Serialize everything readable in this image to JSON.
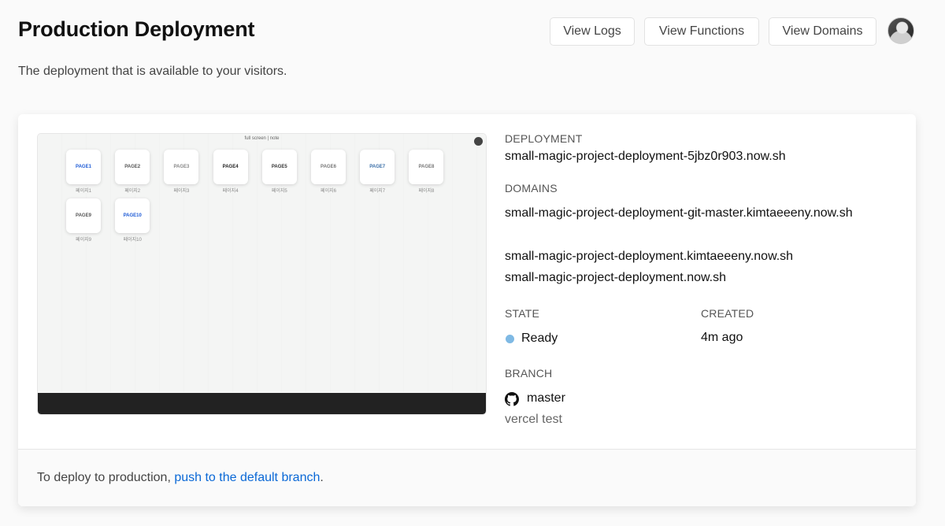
{
  "header": {
    "title": "Production Deployment",
    "subtitle": "The deployment that is available to your visitors.",
    "buttons": {
      "view_logs": "View Logs",
      "view_functions": "View Functions",
      "view_domains": "View Domains"
    }
  },
  "preview": {
    "top_text": "full screen | note",
    "tiles": [
      {
        "label": "PAGE1",
        "sub": "페이지1",
        "color": "#1e5bd6"
      },
      {
        "label": "PAGE2",
        "sub": "페이지2",
        "color": "#555555"
      },
      {
        "label": "PAGE3",
        "sub": "페이지3",
        "color": "#888888"
      },
      {
        "label": "PAGE4",
        "sub": "페이지4",
        "color": "#222222"
      },
      {
        "label": "PAGE5",
        "sub": "페이지5",
        "color": "#333333"
      },
      {
        "label": "PAGE6",
        "sub": "페이지6",
        "color": "#777777"
      },
      {
        "label": "PAGE7",
        "sub": "페이지7",
        "color": "#3b6fa8"
      },
      {
        "label": "PAGE8",
        "sub": "페이지8",
        "color": "#777777"
      },
      {
        "label": "PAGE9",
        "sub": "페이지9",
        "color": "#555555"
      },
      {
        "label": "PAGE10",
        "sub": "페이지10",
        "color": "#1e5bd6"
      }
    ]
  },
  "details": {
    "deployment_label": "DEPLOYMENT",
    "deployment_url": "small-magic-project-deployment-5jbz0r903.now.sh",
    "domains_label": "DOMAINS",
    "domains": [
      "small-magic-project-deployment-git-master.kimtaeeeny.now.sh",
      "small-magic-project-deployment.kimtaeeeny.now.sh",
      "small-magic-project-deployment.now.sh"
    ],
    "state_label": "STATE",
    "state_value": "Ready",
    "state_color": "#7fb9e4",
    "created_label": "CREATED",
    "created_value": "4m ago",
    "branch_label": "BRANCH",
    "branch_value": "master",
    "commit_message": "vercel test"
  },
  "footer": {
    "text": "To deploy to production, ",
    "link": "push to the default branch",
    "suffix": "."
  }
}
